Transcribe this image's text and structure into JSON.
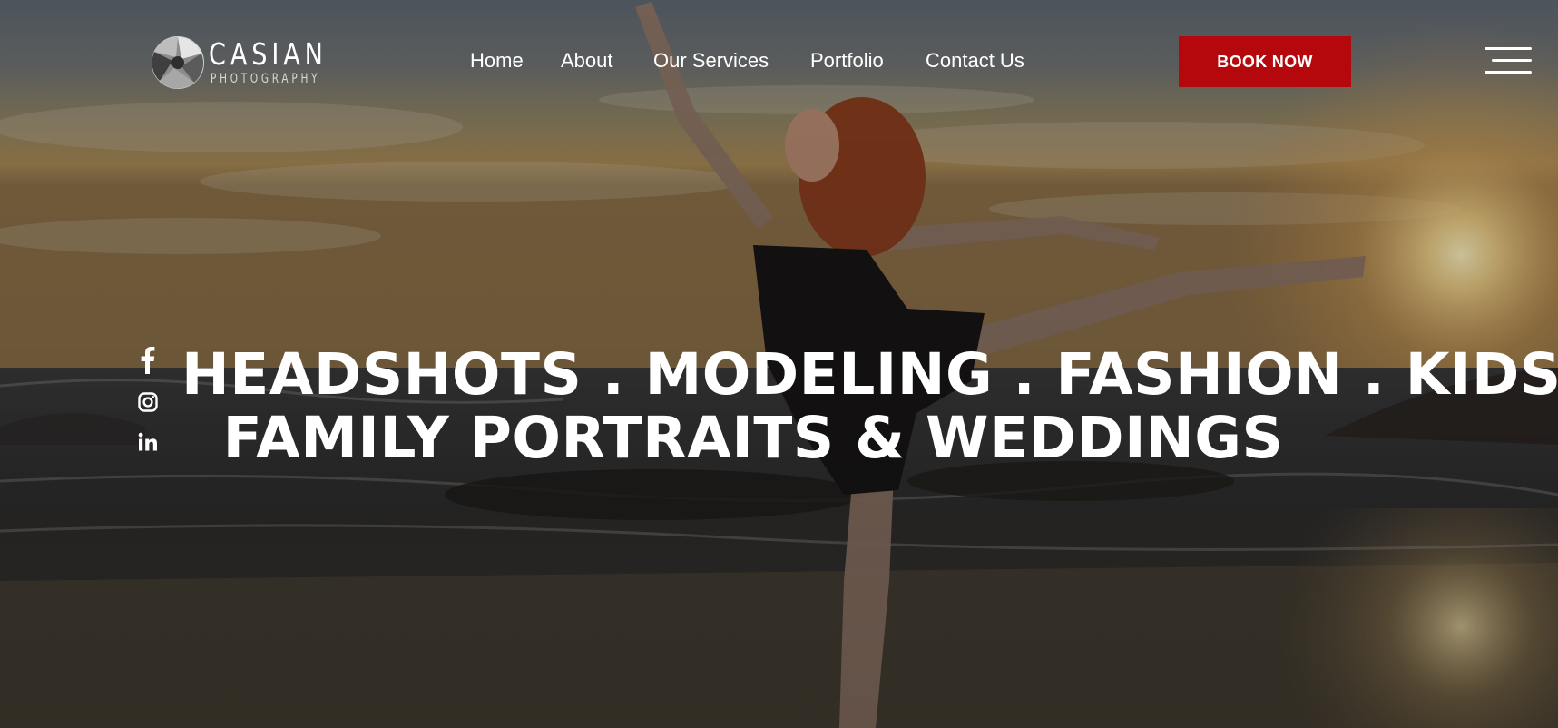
{
  "brand": {
    "name": "CASIAN",
    "tagline": "PHOTOGRAPHY"
  },
  "nav": {
    "items": [
      {
        "label": "Home"
      },
      {
        "label": "About"
      },
      {
        "label": "Our Services"
      },
      {
        "label": "Portfolio"
      },
      {
        "label": "Contact Us"
      }
    ],
    "cta_label": "BOOK NOW",
    "cta_color": "#b5080d"
  },
  "social": [
    {
      "icon": "facebook-icon"
    },
    {
      "icon": "instagram-icon"
    },
    {
      "icon": "linkedin-icon"
    }
  ],
  "hero": {
    "headline_line1": "HEADSHOTS . MODELING . FASHION . KIDS .",
    "headline_line2": "FAMILY PORTRAITS & WEDDINGS"
  }
}
